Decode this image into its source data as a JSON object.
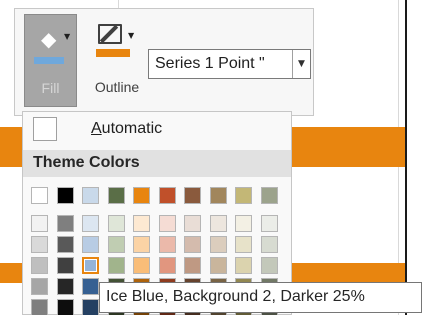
{
  "toolbar": {
    "fill_label": "Fill",
    "outline_label": "Outline",
    "fill_icon": "paint-bucket-icon",
    "outline_icon": "pen-outline-icon",
    "fill_color": "#6fa8dc",
    "outline_color": "#e8850f",
    "series_select": {
      "value": "Series 1 Point \""
    }
  },
  "palette": {
    "automatic_prefix": "A",
    "automatic_rest": "utomatic",
    "theme_colors_label": "Theme Colors",
    "top_row": [
      "#ffffff",
      "#000000",
      "#c9d9ea",
      "#5a6e47",
      "#e8850f",
      "#c0502a",
      "#8a5a3d",
      "#a1865c",
      "#c3b776",
      "#9ca38c"
    ],
    "shades": [
      [
        "#f2f2f2",
        "#d9d9d9",
        "#bfbfbf",
        "#a6a6a6",
        "#7f7f7f"
      ],
      [
        "#7f7f7f",
        "#595959",
        "#404040",
        "#262626",
        "#0d0d0d"
      ],
      [
        "#dce6f1",
        "#b8cce4",
        "#95b3d7",
        "#366092",
        "#244062"
      ],
      [
        "#dfe6d8",
        "#c0cdb2",
        "#a1b48c",
        "#435235",
        "#2d3723"
      ],
      [
        "#fde9d2",
        "#fbd3a5",
        "#f9bd78",
        "#ae630b",
        "#744207"
      ],
      [
        "#f5dcd4",
        "#ebb9aa",
        "#e1967f",
        "#903c1f",
        "#602815"
      ],
      [
        "#e9ddd6",
        "#d4bbad",
        "#bf9983",
        "#67432e",
        "#452d1f"
      ],
      [
        "#ede6de",
        "#dbcdbd",
        "#c9b59c",
        "#796445",
        "#51432e"
      ],
      [
        "#f3f0e4",
        "#e7e2c9",
        "#dbd3ae",
        "#928851",
        "#615b36"
      ],
      [
        "#ebede8",
        "#d7dbd1",
        "#c3c8ba",
        "#727966",
        "#4c5144"
      ]
    ],
    "selected": {
      "col": 2,
      "row": 2
    }
  },
  "tooltip": {
    "text": "Ice Blue, Background 2, Darker 25%"
  }
}
